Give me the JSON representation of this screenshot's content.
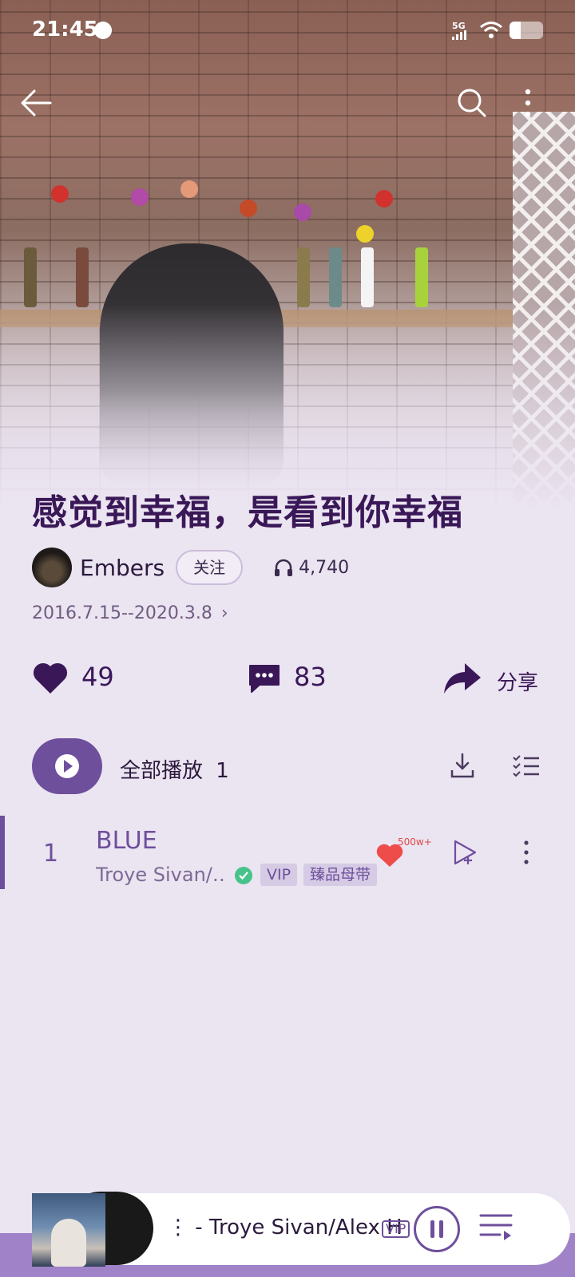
{
  "status": {
    "time": "21:45",
    "network": "5G"
  },
  "playlist": {
    "title": "感觉到幸福，是看到你幸福",
    "author": "Embers",
    "follow_label": "关注",
    "play_count": "4,740",
    "date_range": "2016.7.15--2020.3.8",
    "likes": "49",
    "comments": "83",
    "share_label": "分享"
  },
  "play_all": {
    "label": "全部播放",
    "count": "1"
  },
  "songs": [
    {
      "index": "1",
      "title": "BLUE",
      "artist": "Troye Sivan/…",
      "tags": [
        "VIP",
        "臻品母带"
      ],
      "heart_count": "500w+"
    }
  ],
  "now_playing": {
    "text": "⋮ - Troye Sivan/Alex H",
    "badge": "VIP"
  },
  "colors": {
    "accent": "#6e4f9c",
    "background": "#ebe4f1",
    "title": "#3a1858"
  }
}
